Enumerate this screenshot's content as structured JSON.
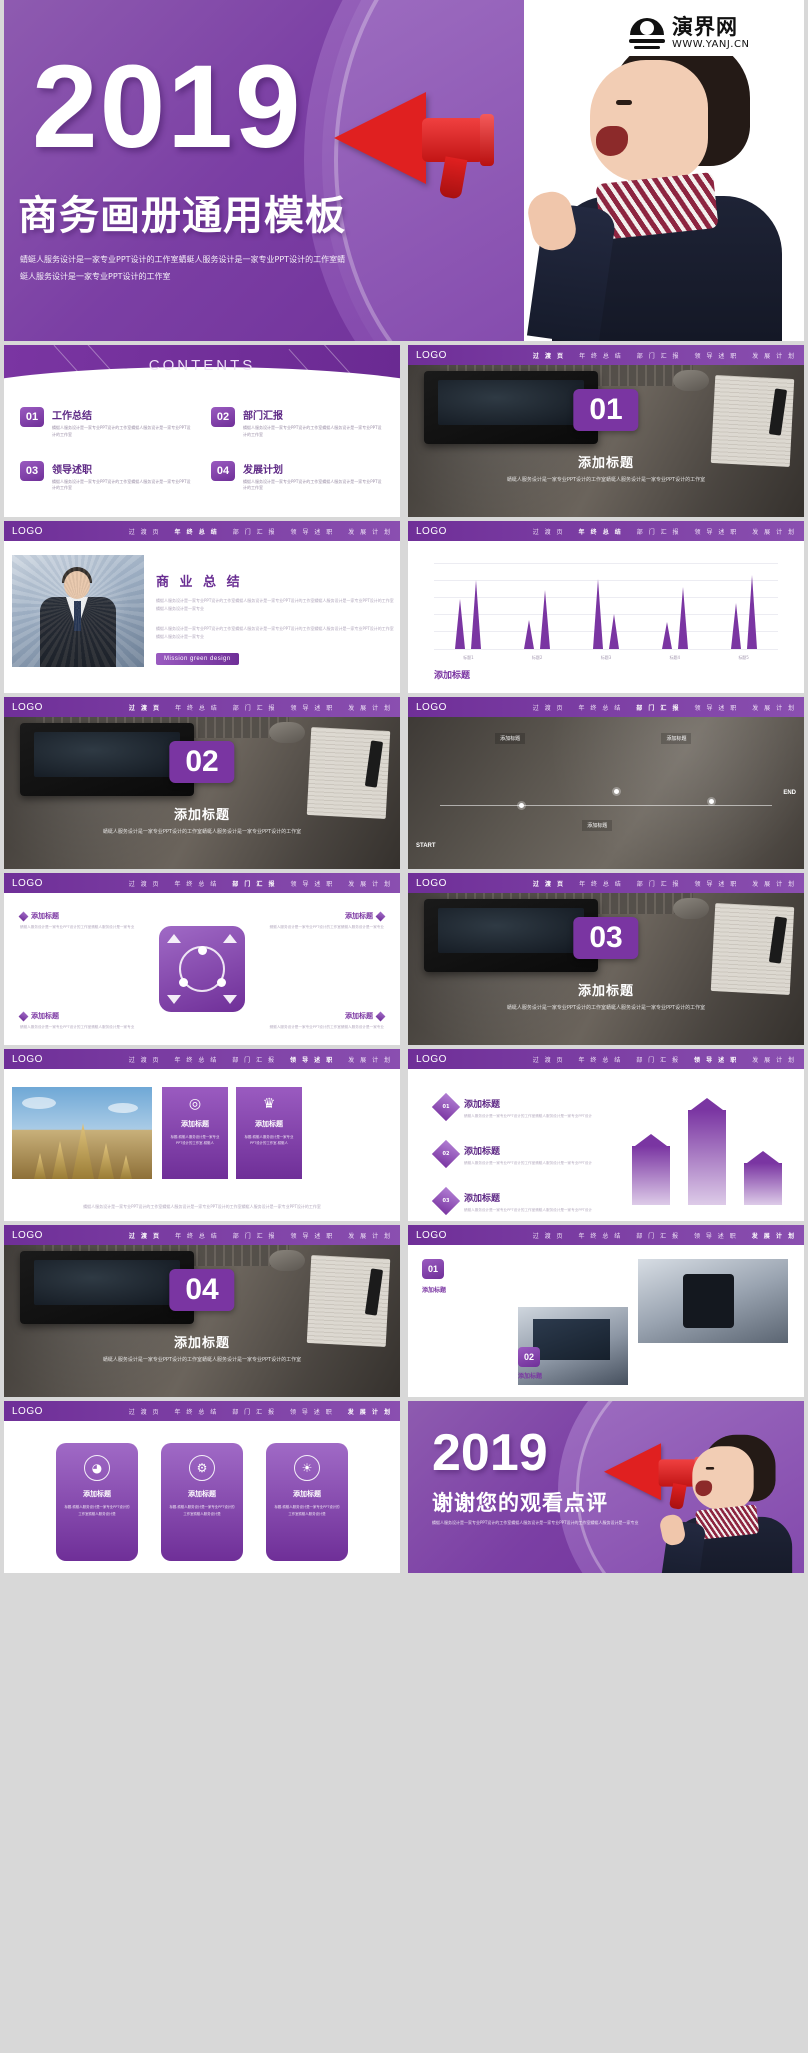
{
  "brand": {
    "watermark_cn": "演界网",
    "watermark_url": "WWW.YANJ.CN",
    "accent": "#7a35a2",
    "accent_dark": "#6f2f98",
    "accent_light": "#a06ac6"
  },
  "hero": {
    "year": "2019",
    "title": "商务画册通用模板",
    "subtitle": "蜻蜓人服务设计是一家专业PPT设计的工作室蜻蜓人服务设计是一家专业PPT设计的工作室蜻蜓人服务设计是一家专业PPT设计的工作室"
  },
  "nav": {
    "logo": "LOGO",
    "items": [
      "过 渡 页",
      "年 终 总 结",
      "部 门 汇 报",
      "领 导 述 职",
      "发 展 计 划"
    ]
  },
  "contents": {
    "title": "CONTENTS",
    "items": [
      {
        "num": "01",
        "label": "工作总结",
        "desc": "蜻蜓人服务设计是一家专业PPT设计的工作室蜻蜓人服务设计是一家专业PPT设计的工作室"
      },
      {
        "num": "02",
        "label": "部门汇报",
        "desc": "蜻蜓人服务设计是一家专业PPT设计的工作室蜻蜓人服务设计是一家专业PPT设计的工作室"
      },
      {
        "num": "03",
        "label": "领导述职",
        "desc": "蜻蜓人服务设计是一家专业PPT设计的工作室蜻蜓人服务设计是一家专业PPT设计的工作室"
      },
      {
        "num": "04",
        "label": "发展计划",
        "desc": "蜻蜓人服务设计是一家专业PPT设计的工作室蜻蜓人服务设计是一家专业PPT设计的工作室"
      }
    ]
  },
  "sections": [
    {
      "num": "01",
      "title": "添加标题",
      "desc": "蜻蜓人服务设计是一家专业PPT设计的工作室蜻蜓人服务设计是一家专业PPT设计的工作室"
    },
    {
      "num": "02",
      "title": "添加标题",
      "desc": "蜻蜓人服务设计是一家专业PPT设计的工作室蜻蜓人服务设计是一家专业PPT设计的工作室"
    },
    {
      "num": "03",
      "title": "添加标题",
      "desc": "蜻蜓人服务设计是一家专业PPT设计的工作室蜻蜓人服务设计是一家专业PPT设计的工作室"
    },
    {
      "num": "04",
      "title": "添加标题",
      "desc": "蜻蜓人服务设计是一家专业PPT设计的工作室蜻蜓人服务设计是一家专业PPT设计的工作室"
    }
  ],
  "business": {
    "title": "商 业 总 结",
    "para1": "蜻蜓人服务设计是一家专业PPT设计的工作室蜻蜓人服务设计是一家专业PPT设计的工作室蜻蜓人服务设计是一家专业PPT设计的工作室蜻蜓人服务设计是一家专业",
    "para2": "蜻蜓人服务设计是一家专业PPT设计的工作室蜻蜓人服务设计是一家专业PPT设计的工作室蜻蜓人服务设计是一家专业PPT设计的工作室蜻蜓人服务设计是一家专业",
    "tag": "Mission green design"
  },
  "chart_data": {
    "type": "bar",
    "title": "添加标题",
    "xlabel": "",
    "ylabel": "",
    "grid": true,
    "legend": "none",
    "ylim": [
      0,
      100
    ],
    "categories": [
      "标题1",
      "标题2",
      "标题3",
      "标题4",
      "标题5"
    ],
    "series": [
      {
        "name": "系列一",
        "values": [
          62,
          36,
          88,
          34,
          58
        ]
      },
      {
        "name": "系列二",
        "values": [
          86,
          74,
          44,
          78,
          92
        ]
      }
    ],
    "tick_labels": [
      "标题1",
      "标题2",
      "标题3",
      "标题4",
      "标题5"
    ],
    "caption": "添加标题"
  },
  "timeline": {
    "start": "START",
    "end": "END",
    "captions": [
      "添加标题",
      "添加标题",
      "添加标题"
    ]
  },
  "diagram": {
    "cards": [
      {
        "title": "添加标题",
        "desc": "蜻蜓人服务设计是一家专业PPT设计的工作室蜻蜓人服务设计是一家专业"
      },
      {
        "title": "添加标题",
        "desc": "蜻蜓人服务设计是一家专业PPT设计的工作室蜻蜓人服务设计是一家专业"
      },
      {
        "title": "添加标题",
        "desc": "蜻蜓人服务设计是一家专业PPT设计的工作室蜻蜓人服务设计是一家专业"
      },
      {
        "title": "添加标题",
        "desc": "蜻蜓人服务设计是一家专业PPT设计的工作室蜻蜓人服务设计是一家专业"
      }
    ]
  },
  "temple": {
    "cards": [
      {
        "icon": "spiral-icon",
        "glyph": "◎",
        "title": "添加标题",
        "desc": "标题-蜻蜓人服务设计是一家专业PPT设计的工作室-蜻蜓人"
      },
      {
        "icon": "shield-icon",
        "glyph": "♛",
        "title": "添加标题",
        "desc": "标题-蜻蜓人服务设计是一家专业PPT设计的工作室-蜻蜓人"
      }
    ],
    "footer": "蜻蜓人服务设计是一家专业PPT设计的工作室蜻蜓人服务设计是一家专业PPT设计的工作室蜻蜓人服务设计是一家专业PPT设计的工作室"
  },
  "arrows": {
    "items": [
      {
        "num": "01",
        "title": "添加标题",
        "desc": "蜻蜓人服务设计是一家专业PPT设计的工作室蜻蜓人服务设计是一家专业PPT设计"
      },
      {
        "num": "02",
        "title": "添加标题",
        "desc": "蜻蜓人服务设计是一家专业PPT设计的工作室蜻蜓人服务设计是一家专业PPT设计"
      },
      {
        "num": "03",
        "title": "添加标题",
        "desc": "蜻蜓人服务设计是一家专业PPT设计的工作室蜻蜓人服务设计是一家专业PPT设计"
      }
    ],
    "bar_values": [
      62,
      100,
      44
    ]
  },
  "photogrid": {
    "items": [
      {
        "num": "01",
        "caption": "添加标题"
      },
      {
        "num": "02",
        "caption": "添加标题"
      }
    ]
  },
  "cards3": [
    {
      "icon": "pie-icon",
      "glyph": "◕",
      "title": "添加标题",
      "desc": "标题-蜻蜓人服务设计是一家专业PPT设计的工作室蜻蜓人服务设计是"
    },
    {
      "icon": "gear-icon",
      "glyph": "⚙",
      "title": "添加标题",
      "desc": "标题-蜻蜓人服务设计是一家专业PPT设计的工作室蜻蜓人服务设计是"
    },
    {
      "icon": "bulb-icon",
      "glyph": "💡",
      "title": "添加标题",
      "desc": "标题-蜻蜓人服务设计是一家专业PPT设计的工作室蜻蜓人服务设计是"
    }
  ],
  "thankyou": {
    "year": "2019",
    "title": "谢谢您的观看点评",
    "subtitle": "蜻蜓人服务设计是一家专业PPT设计的工作室蜻蜓人服务设计是一家专业PPT设计的工作室蜻蜓人服务设计是一家专业"
  }
}
